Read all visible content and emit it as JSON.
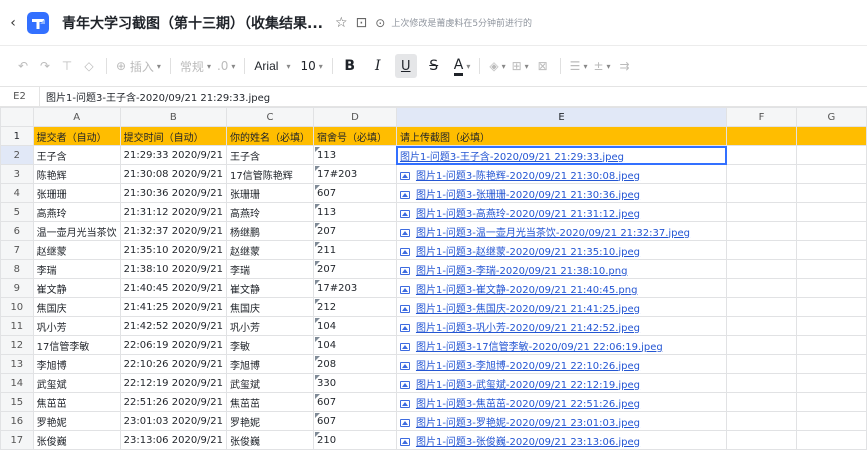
{
  "titlebar": {
    "back_glyph": "‹",
    "doc_title": "青年大学习截图（第十三期）（收集结果...",
    "save_status": "上次修改是莆虔料在5分钟前进行的"
  },
  "toolbar": {
    "insert_label": "插入",
    "format_label": "常规",
    "decimals_label": ".0",
    "font_family": "Arial",
    "font_size": "10",
    "bold": "B",
    "italic": "I",
    "underline": "U",
    "strike": "S",
    "text_color": "A"
  },
  "formula_bar": {
    "cell_ref": "E2",
    "content": "图片1-问题3-王子含-2020/09/21 21:29:33.jpeg"
  },
  "grid": {
    "columns": [
      "A",
      "B",
      "C",
      "D",
      "E",
      "F",
      "G"
    ],
    "selected_column": "E",
    "selected_row": 2,
    "header_row": {
      "num": "1",
      "a": "提交者（自动）",
      "b": "提交时间（自动）",
      "c": "你的姓名（必填）",
      "d": "宿舍号（必填）",
      "e": "请上传截图（必填）"
    },
    "rows": [
      {
        "num": "2",
        "a": "王子含",
        "b": "2020/9/21 21:29:33",
        "c": "王子含",
        "d": "113",
        "e": "图片1-问题3-王子含-2020/09/21 21:29:33.jpeg"
      },
      {
        "num": "3",
        "a": "陈艳辉",
        "b": "2020/9/21 21:30:08",
        "c": "17信管陈艳辉",
        "d": "17#203",
        "e": "图片1-问题3-陈艳辉-2020/09/21 21:30:08.jpeg"
      },
      {
        "num": "4",
        "a": "张珊珊",
        "b": "2020/9/21 21:30:36",
        "c": "张珊珊",
        "d": "607",
        "e": "图片1-问题3-张珊珊-2020/09/21 21:30:36.jpeg"
      },
      {
        "num": "5",
        "a": "高燕玲",
        "b": "2020/9/21 21:31:12",
        "c": "高燕玲",
        "d": "113",
        "e": "图片1-问题3-高燕玲-2020/09/21 21:31:12.jpeg"
      },
      {
        "num": "6",
        "a": "温一壶月光当茶饮",
        "b": "2020/9/21 21:32:37",
        "c": "杨继鹏",
        "d": "207",
        "e": "图片1-问题3-温一壶月光当茶饮-2020/09/21 21:32:37.jpeg"
      },
      {
        "num": "7",
        "a": "赵继蒙",
        "b": "2020/9/21 21:35:10",
        "c": "赵继蒙",
        "d": "211",
        "e": "图片1-问题3-赵继蒙-2020/09/21 21:35:10.jpeg"
      },
      {
        "num": "8",
        "a": "李瑞",
        "b": "2020/9/21 21:38:10",
        "c": "李瑞",
        "d": "207",
        "e": "图片1-问题3-李瑞-2020/09/21 21:38:10.png"
      },
      {
        "num": "9",
        "a": "崔文静",
        "b": "2020/9/21 21:40:45",
        "c": "崔文静",
        "d": "17#203",
        "e": "图片1-问题3-崔文静-2020/09/21 21:40:45.png"
      },
      {
        "num": "10",
        "a": "焦国庆",
        "b": "2020/9/21 21:41:25",
        "c": "焦国庆",
        "d": "212",
        "e": "图片1-问题3-焦国庆-2020/09/21 21:41:25.jpeg"
      },
      {
        "num": "11",
        "a": "巩小芳",
        "b": "2020/9/21 21:42:52",
        "c": "巩小芳",
        "d": "104",
        "e": "图片1-问题3-巩小芳-2020/09/21 21:42:52.jpeg"
      },
      {
        "num": "12",
        "a": "17信管李敏",
        "b": "2020/9/21 22:06:19",
        "c": "李敏",
        "d": "104",
        "e": "图片1-问题3-17信管李敏-2020/09/21 22:06:19.jpeg"
      },
      {
        "num": "13",
        "a": "李旭博",
        "b": "2020/9/21 22:10:26",
        "c": "李旭博",
        "d": "208",
        "e": "图片1-问题3-李旭博-2020/09/21 22:10:26.jpeg"
      },
      {
        "num": "14",
        "a": "武玺斌",
        "b": "2020/9/21 22:12:19",
        "c": "武玺斌",
        "d": "330",
        "e": "图片1-问题3-武玺斌-2020/09/21 22:12:19.jpeg"
      },
      {
        "num": "15",
        "a": "焦茁茁",
        "b": "2020/9/21 22:51:26",
        "c": "焦茁茁",
        "d": "607",
        "e": "图片1-问题3-焦茁茁-2020/09/21 22:51:26.jpeg"
      },
      {
        "num": "16",
        "a": "罗艳妮",
        "b": "2020/9/21 23:01:03",
        "c": "罗艳妮",
        "d": "607",
        "e": "图片1-问题3-罗艳妮-2020/09/21 23:01:03.jpeg"
      },
      {
        "num": "17",
        "a": "张俊巍",
        "b": "2020/9/21 23:13:06",
        "c": "张俊巍",
        "d": "210",
        "e": "图片1-问题3-张俊巍-2020/09/21 23:13:06.jpeg"
      }
    ]
  },
  "colors": {
    "header_fill": "#ffbd00",
    "link": "#2456d3",
    "selection": "#3370ff"
  }
}
